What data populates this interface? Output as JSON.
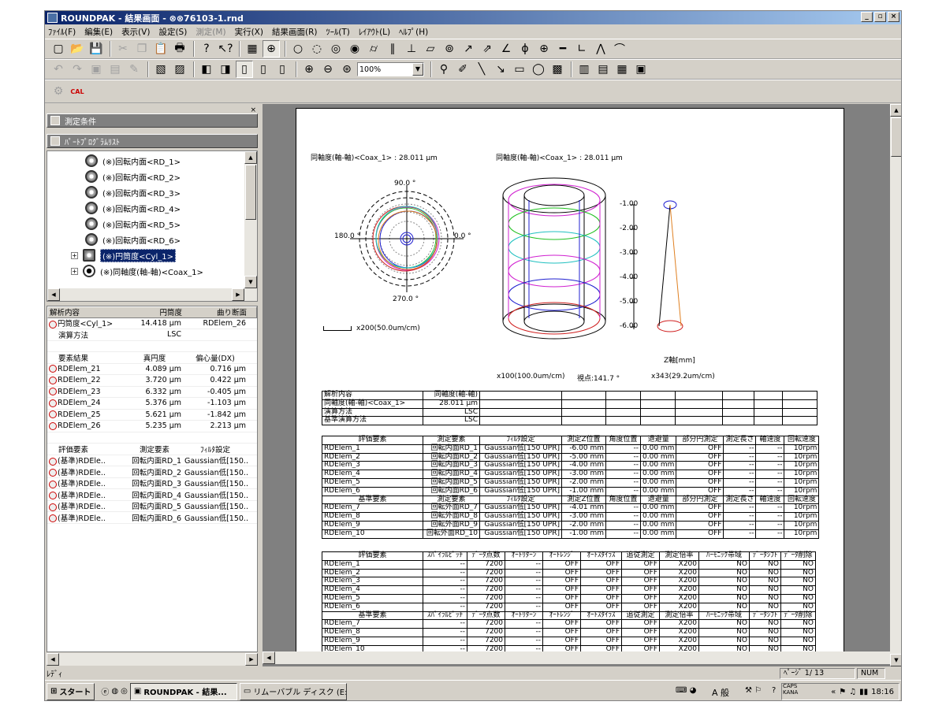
{
  "window": {
    "title": "ROUNDPAK - 結果画面 - ⊗⊗76103-1.rnd"
  },
  "menu": [
    "ﾌｧｲﾙ(F)",
    "編集(E)",
    "表示(V)",
    "設定(S)",
    "測定(M)",
    "実行(X)",
    "結果画面(R)",
    "ﾂｰﾙ(T)",
    "ﾚｲｱｳﾄ(L)",
    "ﾍﾙﾌﾟ(H)"
  ],
  "menu_disabled_index": 4,
  "zoom": "100%",
  "left_panel": {
    "measure_header": "測定条件",
    "program_header": "ﾊﾟｰﾄﾌﾟﾛｸﾞﾗﾑﾘｽﾄ",
    "tree": [
      "(※)回転内面<RD_1>",
      "(※)回転内面<RD_2>",
      "(※)回転内面<RD_3>",
      "(※)回転内面<RD_4>",
      "(※)回転内面<RD_5>",
      "(※)回転内面<RD_6>",
      "(※)円筒度<Cyl_1>",
      "(※)同軸度(軸-軸)<Coax_1>"
    ],
    "grid_header": [
      "解析内容",
      "円筒度",
      "曲り断面"
    ],
    "grid_rows": [
      [
        "円筒度<Cyl_1>",
        "14.418 μm",
        "RDElem_26"
      ],
      [
        "演算方法",
        "LSC",
        ""
      ],
      [
        "",
        "",
        ""
      ],
      [
        "要素結果",
        "真円度",
        "偏心量(DX)"
      ],
      [
        "RDElem_21",
        "4.089 μm",
        "0.716 μm"
      ],
      [
        "RDElem_22",
        "3.720 μm",
        "0.422 μm"
      ],
      [
        "RDElem_23",
        "6.332 μm",
        "-0.405 μm"
      ],
      [
        "RDElem_24",
        "5.376 μm",
        "-1.103 μm"
      ],
      [
        "RDElem_25",
        "5.621 μm",
        "-1.842 μm"
      ],
      [
        "RDElem_26",
        "5.235 μm",
        "2.213 μm"
      ],
      [
        "",
        "",
        ""
      ],
      [
        "評価要素",
        "測定要素",
        "ﾌｨﾙﾀ設定"
      ],
      [
        "(基準)RDEle..",
        "回転内面RD_1",
        "Gaussian低[150.."
      ],
      [
        "(基準)RDEle..",
        "回転内面RD_2",
        "Gaussian低[150.."
      ],
      [
        "(基準)RDEle..",
        "回転内面RD_3",
        "Gaussian低[150.."
      ],
      [
        "(基準)RDEle..",
        "回転内面RD_4",
        "Gaussian低[150.."
      ],
      [
        "(基準)RDEle..",
        "回転内面RD_5",
        "Gaussian低[150.."
      ],
      [
        "(基準)RDEle..",
        "回転内面RD_6",
        "Gaussian低[150.."
      ]
    ]
  },
  "report": {
    "title_left": "同軸度(軸-軸)<Coax_1> : 28.011 μm",
    "title_right": "同軸度(軸-軸)<Coax_1> : 28.011 μm",
    "polar_labels": {
      "top": "90.0 °",
      "left": "180.0 °",
      "right": "0.0 °",
      "bottom": "270.0 °"
    },
    "polar_scale": "x200(50.0um/cm)",
    "z_ticks": [
      "-1.00",
      "-2.00",
      "-3.00",
      "-4.00",
      "-5.00",
      "-6.00"
    ],
    "z_axis_label": "Z軸[mm]",
    "scale_3d": "x100(100.0um/cm)",
    "view_point": "視点:141.7 °",
    "scale_z": "x343(29.2um/cm)",
    "t1": [
      [
        "解析内容",
        "同軸度(軸-軸)"
      ],
      [
        "同軸度(軸-軸)<Coax_1>",
        "28.011 μm"
      ],
      [
        "演算方法",
        "LSC"
      ],
      [
        "基準演算方法",
        "LSC"
      ]
    ],
    "t2_header": [
      "評価要素",
      "測定要素",
      "ﾌｨﾙﾀ設定",
      "測定Z位置",
      "角度位置",
      "退避量",
      "部分円測定",
      "測定長さ",
      "軸速度",
      "回転速度"
    ],
    "t2_rows": [
      [
        "RDElem_1",
        "回転内面RD_1",
        "Gaussian低[150 UPR]",
        "-6.00 mm",
        "--",
        "0.00 mm",
        "OFF",
        "--",
        "--",
        "10rpm"
      ],
      [
        "RDElem_2",
        "回転内面RD_2",
        "Gaussian低[150 UPR]",
        "-5.00 mm",
        "--",
        "0.00 mm",
        "OFF",
        "--",
        "--",
        "10rpm"
      ],
      [
        "RDElem_3",
        "回転内面RD_3",
        "Gaussian低[150 UPR]",
        "-4.00 mm",
        "--",
        "0.00 mm",
        "OFF",
        "--",
        "--",
        "10rpm"
      ],
      [
        "RDElem_4",
        "回転内面RD_4",
        "Gaussian低[150 UPR]",
        "-3.00 mm",
        "--",
        "0.00 mm",
        "OFF",
        "--",
        "--",
        "10rpm"
      ],
      [
        "RDElem_5",
        "回転内面RD_5",
        "Gaussian低[150 UPR]",
        "-2.00 mm",
        "--",
        "0.00 mm",
        "OFF",
        "--",
        "--",
        "10rpm"
      ],
      [
        "RDElem_6",
        "回転内面RD_6",
        "Gaussian低[150 UPR]",
        "-1.00 mm",
        "--",
        "0.00 mm",
        "OFF",
        "--",
        "--",
        "10rpm"
      ]
    ],
    "t2b_header": [
      "基準要素",
      "測定要素",
      "ﾌｨﾙﾀ設定",
      "測定Z位置",
      "角度位置",
      "退避量",
      "部分円測定",
      "測定長さ",
      "軸速度",
      "回転速度"
    ],
    "t2b_rows": [
      [
        "RDElem_7",
        "回転外面RD_7",
        "Gaussian低[150 UPR]",
        "-4.01 mm",
        "--",
        "0.00 mm",
        "OFF",
        "--",
        "--",
        "10rpm"
      ],
      [
        "RDElem_8",
        "回転外面RD_8",
        "Gaussian低[150 UPR]",
        "-3.00 mm",
        "--",
        "0.00 mm",
        "OFF",
        "--",
        "--",
        "10rpm"
      ],
      [
        "RDElem_9",
        "回転外面RD_9",
        "Gaussian低[150 UPR]",
        "-2.00 mm",
        "--",
        "0.00 mm",
        "OFF",
        "--",
        "--",
        "10rpm"
      ],
      [
        "RDElem_10",
        "回転外面RD_10",
        "Gaussian低[150 UPR]",
        "-1.00 mm",
        "--",
        "0.00 mm",
        "OFF",
        "--",
        "--",
        "10rpm"
      ]
    ],
    "t3_header": [
      "評価要素",
      "ｽﾊﾟｲﾗﾙﾋﾟｯﾁ",
      "ﾃﾞｰﾀ点数",
      "ｵｰﾄﾘﾀｰﾝ",
      "ｵｰﾄﾚﾝｼﾞ",
      "ｵｰﾄｽﾀｲﾗｽ",
      "追従測定",
      "測定倍率",
      "ﾊｰﾓﾆｯｸ帯域",
      "ﾃﾞｰﾀｼﾌﾄ",
      "ﾃﾞｰﾀ削除"
    ],
    "t3_rows": [
      [
        "RDElem_1",
        "--",
        "7200",
        "--",
        "OFF",
        "OFF",
        "OFF",
        "X200",
        "NO",
        "NO",
        "NO"
      ],
      [
        "RDElem_2",
        "--",
        "7200",
        "--",
        "OFF",
        "OFF",
        "OFF",
        "X200",
        "NO",
        "NO",
        "NO"
      ],
      [
        "RDElem_3",
        "--",
        "7200",
        "--",
        "OFF",
        "OFF",
        "OFF",
        "X200",
        "NO",
        "NO",
        "NO"
      ],
      [
        "RDElem_4",
        "--",
        "7200",
        "--",
        "OFF",
        "OFF",
        "OFF",
        "X200",
        "NO",
        "NO",
        "NO"
      ],
      [
        "RDElem_5",
        "--",
        "7200",
        "--",
        "OFF",
        "OFF",
        "OFF",
        "X200",
        "NO",
        "NO",
        "NO"
      ],
      [
        "RDElem_6",
        "--",
        "7200",
        "--",
        "OFF",
        "OFF",
        "OFF",
        "X200",
        "NO",
        "NO",
        "NO"
      ]
    ],
    "t3b_header": [
      "基準要素",
      "ｽﾊﾟｲﾗﾙﾋﾟｯﾁ",
      "ﾃﾞｰﾀ点数",
      "ｵｰﾄﾘﾀｰﾝ",
      "ｵｰﾄﾚﾝｼﾞ",
      "ｵｰﾄｽﾀｲﾗｽ",
      "追従測定",
      "測定倍率",
      "ﾊｰﾓﾆｯｸ帯域",
      "ﾃﾞｰﾀｼﾌﾄ",
      "ﾃﾞｰﾀ削除"
    ],
    "t3b_rows": [
      [
        "RDElem_7",
        "--",
        "7200",
        "--",
        "OFF",
        "OFF",
        "OFF",
        "X200",
        "NO",
        "NO",
        "NO"
      ],
      [
        "RDElem_8",
        "--",
        "7200",
        "--",
        "OFF",
        "OFF",
        "OFF",
        "X200",
        "NO",
        "NO",
        "NO"
      ],
      [
        "RDElem_9",
        "--",
        "7200",
        "--",
        "OFF",
        "OFF",
        "OFF",
        "X200",
        "NO",
        "NO",
        "NO"
      ],
      [
        "RDElem_10",
        "--",
        "7200",
        "--",
        "OFF",
        "OFF",
        "OFF",
        "X200",
        "NO",
        "NO",
        "NO"
      ]
    ]
  },
  "status": {
    "left": "ﾚﾃﾞｨ",
    "page": "ﾍﾟｰｼﾞ 1/ 13",
    "num": "NUM"
  },
  "taskbar": {
    "start": "スタート",
    "tasks": [
      "ROUNDPAK - 結果...",
      "リムーバブル ディスク (E:)"
    ],
    "ime": "A 般",
    "caps": "CAPS KANA",
    "clock": "18:16"
  }
}
